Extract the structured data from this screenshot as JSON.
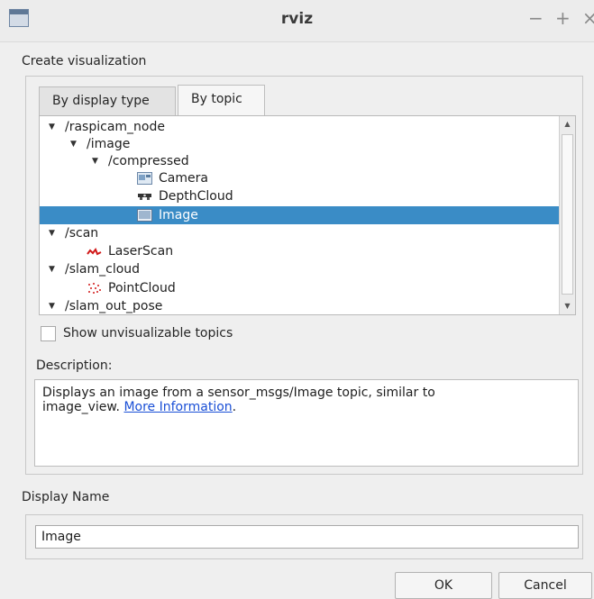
{
  "window": {
    "title": "rviz",
    "minimize_glyph": "−",
    "maximize_glyph": "+",
    "close_glyph": "×"
  },
  "create_label": "Create visualization",
  "tabs": [
    {
      "label": "By display type",
      "active": false
    },
    {
      "label": "By topic",
      "active": true
    }
  ],
  "tree": [
    {
      "text": "/raspicam_node",
      "expanded": true,
      "icon": "none",
      "selected": false
    },
    {
      "text": "/image",
      "expanded": true,
      "icon": "none",
      "selected": false
    },
    {
      "text": "/compressed",
      "expanded": true,
      "icon": "none",
      "selected": false
    },
    {
      "text": "Camera",
      "icon": "camera-icon",
      "selected": false
    },
    {
      "text": "DepthCloud",
      "icon": "depthcloud-icon",
      "selected": false
    },
    {
      "text": "Image",
      "icon": "image-icon",
      "selected": true
    },
    {
      "text": "/scan",
      "expanded": true,
      "icon": "none",
      "selected": false
    },
    {
      "text": "LaserScan",
      "icon": "laserscan-icon",
      "selected": false
    },
    {
      "text": "/slam_cloud",
      "expanded": true,
      "icon": "none",
      "selected": false
    },
    {
      "text": "PointCloud",
      "icon": "pointcloud-icon",
      "selected": false
    },
    {
      "text": "/slam_out_pose",
      "expanded": true,
      "icon": "none",
      "selected": false
    }
  ],
  "show_unvisualizable": {
    "label": "Show unvisualizable topics",
    "checked": false
  },
  "description": {
    "label": "Description:",
    "text_line1": "Displays an image from a sensor_msgs/Image topic, similar to",
    "text_line2": "image_view.",
    "link": "More Information",
    "trailing": "."
  },
  "display_name": {
    "label": "Display Name",
    "value": "Image"
  },
  "buttons": {
    "ok": "OK",
    "cancel": "Cancel"
  },
  "colors": {
    "selection": "#3a8cc6",
    "link": "#1a4fd6"
  }
}
